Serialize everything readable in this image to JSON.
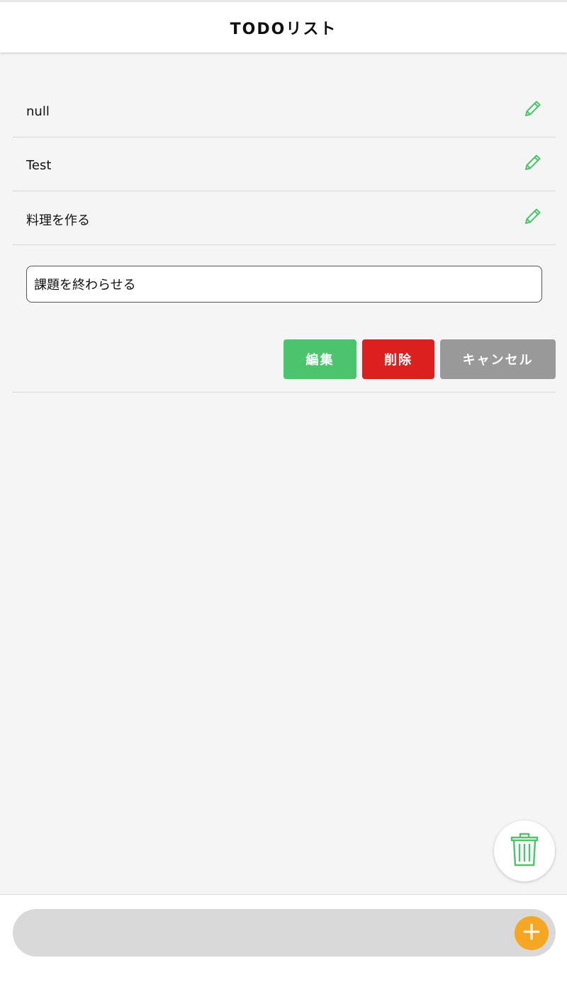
{
  "header": {
    "title": "TODOリスト"
  },
  "todos": [
    {
      "label": "null"
    },
    {
      "label": "Test"
    },
    {
      "label": "料理を作る"
    }
  ],
  "edit_panel": {
    "input_value": "課題を終わらせる",
    "edit_label": "編集",
    "delete_label": "削除",
    "cancel_label": "キャンセル"
  },
  "new_todo": {
    "input_value": "",
    "placeholder": ""
  },
  "icons": {
    "edit": "pencil-icon",
    "trash": "trash-icon",
    "add": "plus-icon"
  },
  "colors": {
    "accent_green": "#4cc46e",
    "delete_red": "#dc2020",
    "cancel_gray": "#999999",
    "add_orange": "#f5a623"
  }
}
